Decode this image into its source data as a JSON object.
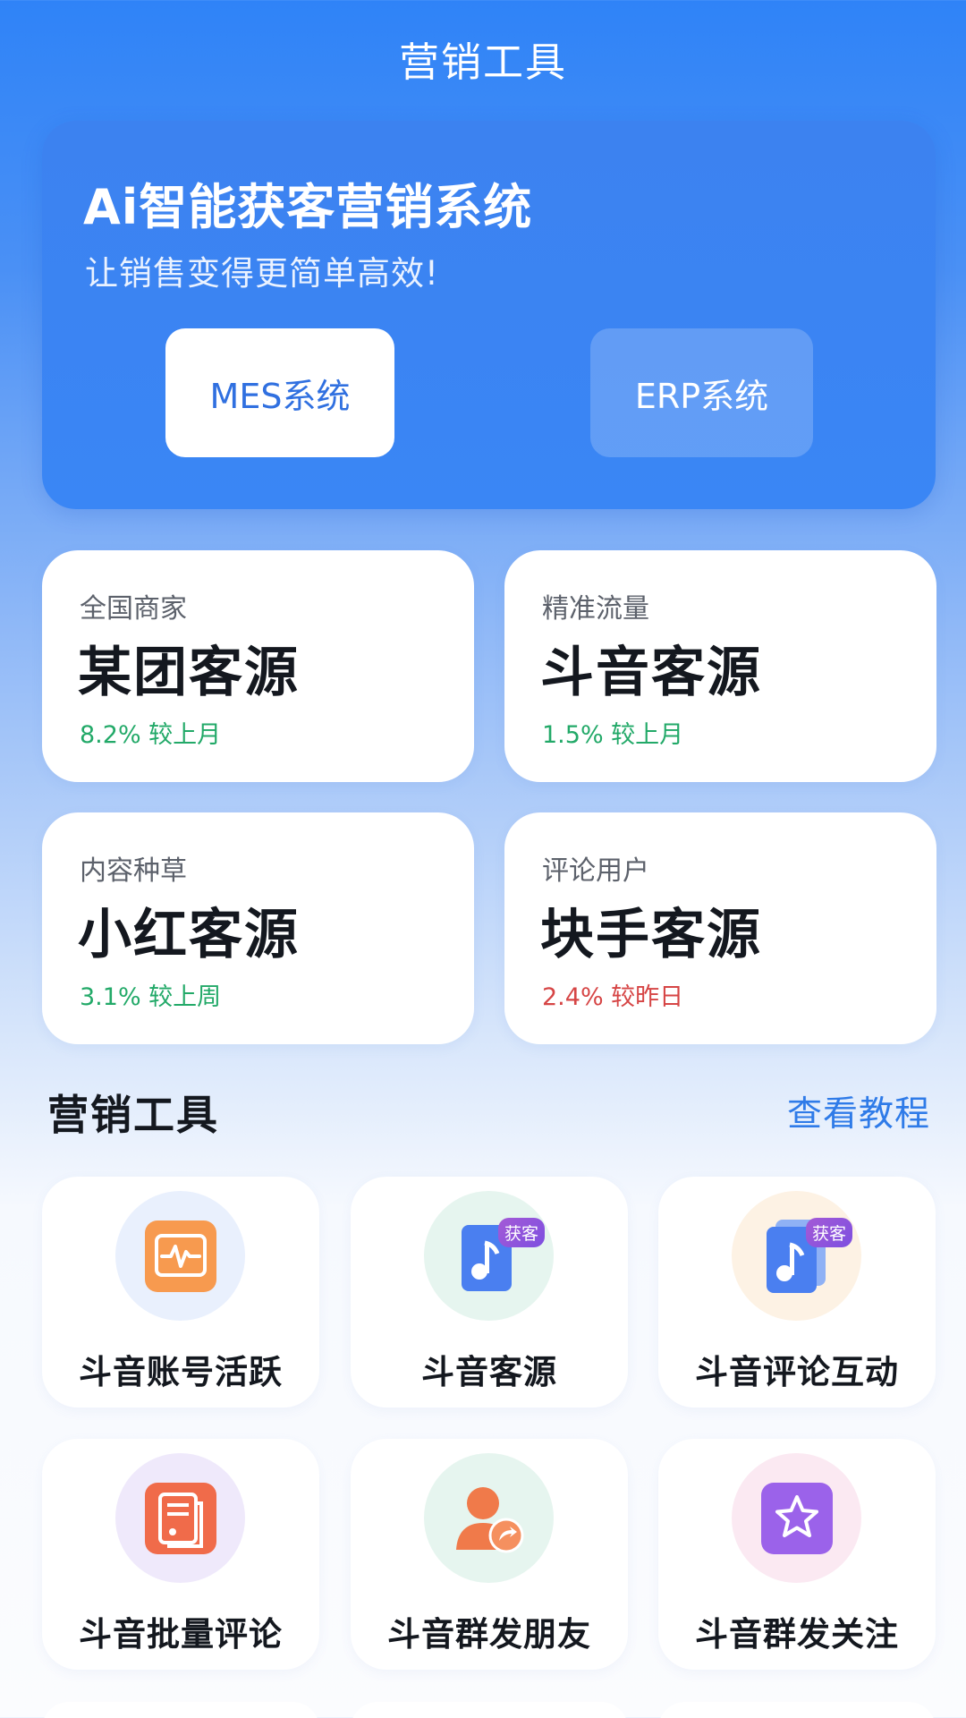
{
  "header": {
    "title": "营销工具"
  },
  "hero": {
    "title": "Ai智能获客营销系统",
    "subtitle": "让销售变得更简单高效!",
    "buttons": {
      "mes": "MES系统",
      "erp": "ERP系统"
    }
  },
  "stats": [
    {
      "category": "全国商家",
      "name": "某团客源",
      "change": "8.2% 较上月",
      "trend": "up"
    },
    {
      "category": "精准流量",
      "name": "斗音客源",
      "change": "1.5% 较上月",
      "trend": "up"
    },
    {
      "category": "内容种草",
      "name": "小红客源",
      "change": "3.1% 较上周",
      "trend": "up"
    },
    {
      "category": "评论用户",
      "name": "块手客源",
      "change": "2.4% 较昨日",
      "trend": "down"
    }
  ],
  "tools_section": {
    "title": "营销工具",
    "link": "查看教程"
  },
  "tools": [
    {
      "label": "斗音账号活跃",
      "icon": "activity-chart-icon",
      "color": "#f79a4f"
    },
    {
      "label": "斗音客源",
      "icon": "music-note-icon",
      "badge": "获客",
      "color": "#4a7ff0"
    },
    {
      "label": "斗音评论互动",
      "icon": "music-note-icon",
      "badge": "获客",
      "color": "#4a7ff0"
    },
    {
      "label": "斗音批量评论",
      "icon": "document-icon",
      "color": "#f06b4a"
    },
    {
      "label": "斗音群发朋友",
      "icon": "user-share-icon",
      "color": "#f07a4a"
    },
    {
      "label": "斗音群发关注",
      "icon": "star-icon",
      "color": "#9b62ea"
    }
  ],
  "colors": {
    "accent": "#2f7be8",
    "up": "#22a968",
    "down": "#d64545"
  }
}
